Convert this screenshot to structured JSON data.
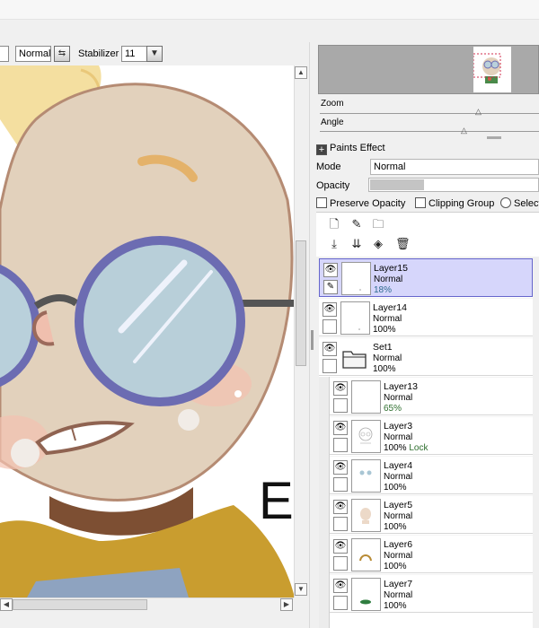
{
  "toolbar": {
    "blend_mode": "Normal",
    "stabilizer_label": "Stabilizer",
    "stabilizer_value": "11"
  },
  "canvas": {
    "partial_text": "E"
  },
  "navigator": {
    "zoom_label": "Zoom",
    "angle_label": "Angle"
  },
  "paints_effect": {
    "label": "Paints Effect"
  },
  "layer_props": {
    "mode_label": "Mode",
    "mode_value": "Normal",
    "opacity_label": "Opacity",
    "opacity_fraction": 0.32,
    "preserve_opacity": "Preserve Opacity",
    "clipping_group": "Clipping Group",
    "select_partial": "Select"
  },
  "layers": [
    {
      "name": "Layer15",
      "mode": "Normal",
      "opacity": "18%",
      "lock": "",
      "selected": true,
      "thumb": "dot"
    },
    {
      "name": "Layer14",
      "mode": "Normal",
      "opacity": "100%",
      "lock": "",
      "selected": false,
      "thumb": "dot"
    },
    {
      "name": "Set1",
      "mode": "Normal",
      "opacity": "100%",
      "lock": "",
      "selected": false,
      "thumb": "folder"
    },
    {
      "name": "Layer13",
      "mode": "Normal",
      "opacity": "65%",
      "lock": "",
      "selected": false,
      "thumb": "blank"
    },
    {
      "name": "Layer3",
      "mode": "Normal",
      "opacity": "100%",
      "lock": "Lock",
      "selected": false,
      "thumb": "sketch"
    },
    {
      "name": "Layer4",
      "mode": "Normal",
      "opacity": "100%",
      "lock": "",
      "selected": false,
      "thumb": "eyes"
    },
    {
      "name": "Layer5",
      "mode": "Normal",
      "opacity": "100%",
      "lock": "",
      "selected": false,
      "thumb": "face"
    },
    {
      "name": "Layer6",
      "mode": "Normal",
      "opacity": "100%",
      "lock": "",
      "selected": false,
      "thumb": "hair"
    },
    {
      "name": "Layer7",
      "mode": "Normal",
      "opacity": "100%",
      "lock": "",
      "selected": false,
      "thumb": "green"
    }
  ]
}
